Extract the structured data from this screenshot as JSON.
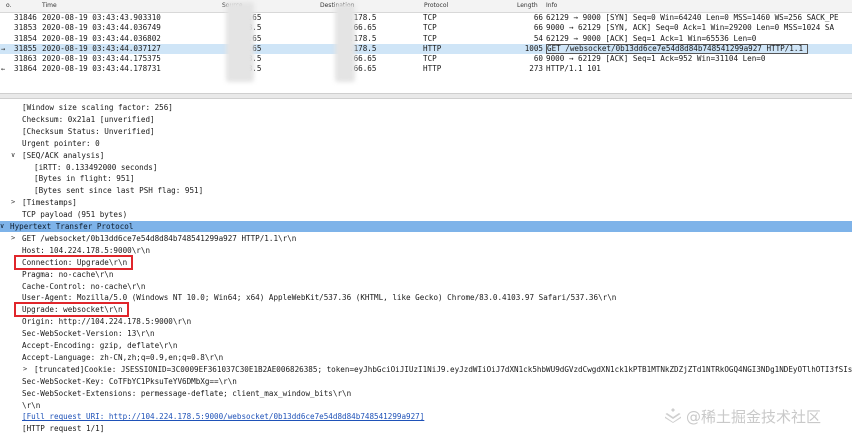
{
  "packet_list": {
    "headers": [
      "o.",
      "Time",
      "Source",
      "Destination",
      "Protocol",
      "Length",
      "Info"
    ],
    "rows": [
      {
        "arrow": "",
        "no": "31846",
        "time": "2020-08-19 03:43:43.903310",
        "src": ".66.65",
        "dst": ".178.5",
        "proto": "TCP",
        "len": "66",
        "info": "62129 → 9000 [SYN] Seq=0 Win=64240 Len=0 MSS=1460 WS=256 SACK_PE"
      },
      {
        "arrow": "",
        "no": "31853",
        "time": "2020-08-19 03:43:44.036749",
        "src": ".178.5",
        "dst": ".66.65",
        "proto": "TCP",
        "len": "66",
        "info": "9000 → 62129 [SYN, ACK] Seq=0 Ack=1 Win=29200 Len=0 MSS=1024 SA"
      },
      {
        "arrow": "",
        "no": "31854",
        "time": "2020-08-19 03:43:44.036802",
        "src": ".66.65",
        "dst": ".178.5",
        "proto": "TCP",
        "len": "54",
        "info": "62129 → 9000 [ACK] Seq=1 Ack=1 Win=65536 Len=0"
      },
      {
        "arrow": "→",
        "no": "31855",
        "time": "2020-08-19 03:43:44.037127",
        "src": ".66.65",
        "dst": ".178.5",
        "proto": "HTTP",
        "len": "1005",
        "info": "GET /websocket/0b13dd6ce7e54d8d84b748541299a927 HTTP/1.1",
        "selected": true
      },
      {
        "arrow": "",
        "no": "31863",
        "time": "2020-08-19 03:43:44.175375",
        "src": ".178.5",
        "dst": ".66.65",
        "proto": "TCP",
        "len": "60",
        "info": "9000 → 62129 [ACK] Seq=1 Ack=952 Win=31104 Len=0"
      },
      {
        "arrow": "←",
        "no": "31864",
        "time": "2020-08-19 03:43:44.178731",
        "src": ".178.5",
        "dst": ".66.65",
        "proto": "HTTP",
        "len": "273",
        "info": "HTTP/1.1 101"
      }
    ]
  },
  "details": {
    "lines": [
      {
        "text": "[Window size scaling factor: 256]",
        "indent": 22
      },
      {
        "text": "Checksum: 0x21a1 [unverified]",
        "indent": 22
      },
      {
        "text": "[Checksum Status: Unverified]",
        "indent": 22
      },
      {
        "text": "Urgent pointer: 0",
        "indent": 22
      },
      {
        "text": "[SEQ/ACK analysis]",
        "indent": 22,
        "expander": "∨"
      },
      {
        "text": "[iRTT: 0.133492000 seconds]",
        "indent": 34
      },
      {
        "text": "[Bytes in flight: 951]",
        "indent": 34
      },
      {
        "text": "[Bytes sent since last PSH flag: 951]",
        "indent": 34
      },
      {
        "text": "[Timestamps]",
        "indent": 22,
        "expander": ">"
      },
      {
        "text": "TCP payload (951 bytes)",
        "indent": 22
      },
      {
        "text": "Hypertext Transfer Protocol",
        "indent": 10,
        "expander": "∨",
        "header": true
      },
      {
        "text": "GET /websocket/0b13dd6ce7e54d8d84b748541299a927 HTTP/1.1\\r\\n",
        "indent": 22,
        "expander": ">"
      },
      {
        "text": "Host: 104.224.178.5:9000\\r\\n",
        "indent": 22
      },
      {
        "text": "Connection: Upgrade\\r\\n",
        "indent": 22,
        "highlight": true
      },
      {
        "text": "Pragma: no-cache\\r\\n",
        "indent": 22
      },
      {
        "text": "Cache-Control: no-cache\\r\\n",
        "indent": 22
      },
      {
        "text": "User-Agent: Mozilla/5.0 (Windows NT 10.0; Win64; x64) AppleWebKit/537.36 (KHTML, like Gecko) Chrome/83.0.4103.97 Safari/537.36\\r\\n",
        "indent": 22
      },
      {
        "text": "Upgrade: websocket\\r\\n",
        "indent": 22,
        "highlight": true
      },
      {
        "text": "Origin: http://104.224.178.5:9000\\r\\n",
        "indent": 22
      },
      {
        "text": "Sec-WebSocket-Version: 13\\r\\n",
        "indent": 22
      },
      {
        "text": "Accept-Encoding: gzip, deflate\\r\\n",
        "indent": 22
      },
      {
        "text": "Accept-Language: zh-CN,zh;q=0.9,en;q=0.8\\r\\n",
        "indent": 22
      },
      {
        "text": "[truncated]Cookie: JSESSIONID=3C0009EF361037C30E1B2AE006826385; token=eyJhbGciOiJIUzI1NiJ9.eyJzdWIiOiJ7dXN1ck5hbWU9dGVzdCwgdXN1ck1kPTB1MTNkZDZjZTd1NTRkOGQ4NGI3NDg1NDEyOTlhOTI3fSIsImV4cCI6MTU5Nzc",
        "indent": 34,
        "expander": ">"
      },
      {
        "text": "Sec-WebSocket-Key: CoTFbYC1PksuTeYV6DMbXg==\\r\\n",
        "indent": 22
      },
      {
        "text": "Sec-WebSocket-Extensions: permessage-deflate; client_max_window_bits\\r\\n",
        "indent": 22
      },
      {
        "text": "\\r\\n",
        "indent": 22
      },
      {
        "text": "[Full request URI: http://104.224.178.5:9000/websocket/0b13dd6ce7e54d8d84b748541299a927]",
        "indent": 22,
        "link": true
      },
      {
        "text": "[HTTP request 1/1]",
        "indent": 22
      }
    ]
  },
  "watermark": {
    "text": "@稀土掘金技术社区"
  },
  "colors": {
    "selected_row": "#cfe5f7",
    "protocol_header": "#7eb3e9",
    "highlight_box": "#e0262b",
    "link": "#1f52b8"
  }
}
